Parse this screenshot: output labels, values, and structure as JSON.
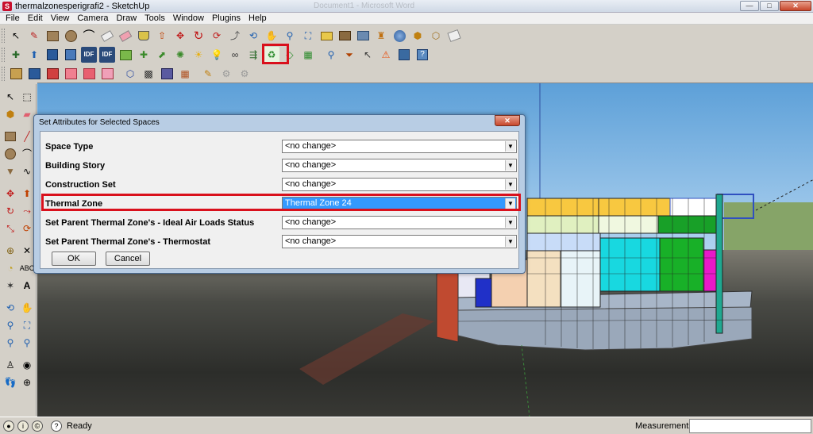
{
  "window": {
    "title": "thermalzonesperigrafi2 - SketchUp",
    "background_title": "Document1 - Microsoft Word",
    "controls": {
      "minimize": "—",
      "maximize": "□",
      "close": "✕"
    }
  },
  "menu": {
    "items": [
      "File",
      "Edit",
      "View",
      "Camera",
      "Draw",
      "Tools",
      "Window",
      "Plugins",
      "Help"
    ]
  },
  "toolbar_icons": {
    "row1": [
      "select-arrow-icon",
      "pencil-icon",
      "rectangle-icon",
      "circle-icon",
      "arc-icon",
      "eraser-icon",
      "eraser-pink-icon",
      "paint-bucket-icon",
      "push-pull-icon",
      "move-icon",
      "rotate-icon",
      "follow-me-icon",
      "offset-icon",
      "orbit-icon",
      "pan-hand-icon",
      "zoom-icon",
      "zoom-extents-icon",
      "folder-open-icon",
      "import-icon",
      "export-icon",
      "walk-icon",
      "texture-icon",
      "components-icon",
      "styles-icon",
      "layers-icon"
    ],
    "row2": [
      "new-space-icon",
      "arrow-up-icon",
      "save-icon",
      "save-as-icon",
      "idf-import-icon",
      "idf-export-icon",
      "add-surface-icon",
      "add-shading-icon",
      "inspector-icon",
      "light-icon",
      "sun-icon",
      "glasses-icon",
      "shade-icon",
      "set-attributes-icon",
      "surface-matching-icon",
      "grid-icon",
      "search-icon",
      "filter-icon",
      "pointer-info-icon",
      "warning-icon",
      "render-blue-icon",
      "help-icon"
    ],
    "row3": [
      "boundary-icon",
      "box-blue-icon",
      "cube-red-icon",
      "cube-pink-icon",
      "cube-pink2-icon",
      "cube-pink3-icon",
      "wireframe-icon",
      "wire-grid-icon",
      "solid-cube-icon",
      "table-icon",
      "edit-icon",
      "tool-gray-icon",
      "tool-gray2-icon"
    ]
  },
  "statusbar": {
    "status": "Ready",
    "measurements_label": "Measurements",
    "icons": [
      "geolocation-icon",
      "credits-icon",
      "copyright-icon",
      "help-icon"
    ]
  },
  "dialog": {
    "title": "Set Attributes for Selected Spaces",
    "close_label": "✕",
    "fields": [
      {
        "label": "Space Type",
        "value": "<no change>"
      },
      {
        "label": "Building Story",
        "value": "<no change>"
      },
      {
        "label": "Construction Set",
        "value": "<no change>"
      },
      {
        "label": "Thermal Zone",
        "value": "Thermal Zone 24"
      },
      {
        "label": "Set Parent Thermal Zone's - Ideal Air Loads Status",
        "value": "<no change>"
      },
      {
        "label": "Set Parent Thermal Zone's - Thermostat",
        "value": "<no change>"
      }
    ],
    "ok_label": "OK",
    "cancel_label": "Cancel",
    "highlight_color": "#3399ff",
    "annotation_color": "#d9101c"
  },
  "viewport": {
    "sky_color": "#5da0d8",
    "ground_color": "#3a3a36"
  }
}
